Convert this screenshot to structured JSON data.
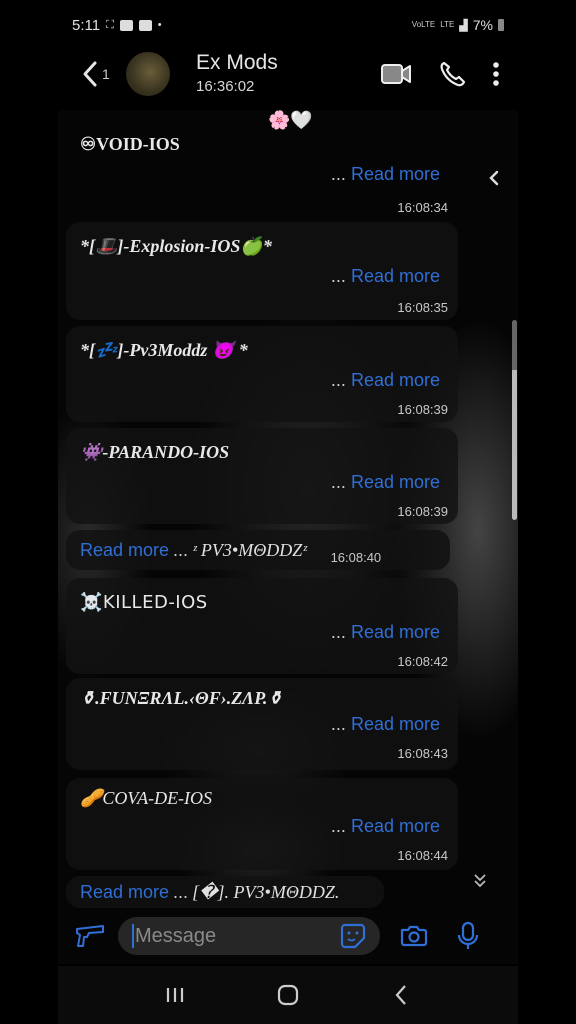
{
  "status_bar": {
    "time": "5:11",
    "network_labels": [
      "VoLTE",
      "LTE"
    ],
    "battery": "7%"
  },
  "header": {
    "back_label": "back",
    "unread_count": "1",
    "contact_name": "Ex Mods",
    "last_seen": "16:36:02",
    "actions": [
      "video-call",
      "voice-call",
      "more-options"
    ]
  },
  "top_emoji": "🌸🤍",
  "messages": [
    {
      "title": "♾VOID-IOS",
      "ellipsis": "...",
      "read_more": "Read more",
      "time": "16:08:34"
    },
    {
      "title": "*[🎩]-Explosion-IOS🍏*",
      "ellipsis": "...",
      "read_more": "Read more",
      "time": "16:08:35"
    },
    {
      "title": "*[💤]-Pv3Moddz 😈 *",
      "ellipsis": "...",
      "read_more": "Read more",
      "time": "16:08:39"
    },
    {
      "title": "👾-PARANDO-IOS",
      "ellipsis": "...",
      "read_more": "Read more",
      "time": "16:08:39"
    },
    {
      "title": "☠️KILLED-IOS",
      "ellipsis": "...",
      "read_more": "Read more",
      "time": "16:08:42"
    },
    {
      "title": "⚱.FUNΞRΛL.‹ΘF›.ZΛP.⚱",
      "ellipsis": "...",
      "read_more": "Read more",
      "time": "16:08:43"
    },
    {
      "title": "🥜COVA-DE-IOS",
      "ellipsis": "...",
      "read_more": "Read more",
      "time": "16:08:44"
    }
  ],
  "short_messages": [
    {
      "read_more": "Read more",
      "ellipsis": "...",
      "signature": "ᶻ PV3•MΘDDZᶻ",
      "time": "16:08:40"
    },
    {
      "read_more": "Read more",
      "ellipsis": "...",
      "signature": "[�]. PV3•MΘDDZ.",
      "time": ""
    }
  ],
  "composer": {
    "placeholder": "Message",
    "value": ""
  },
  "navbar": [
    "recent-apps",
    "home",
    "back"
  ],
  "colors": {
    "accent": "#2f6fd6",
    "bubble": "#121212",
    "background": "#000000"
  }
}
